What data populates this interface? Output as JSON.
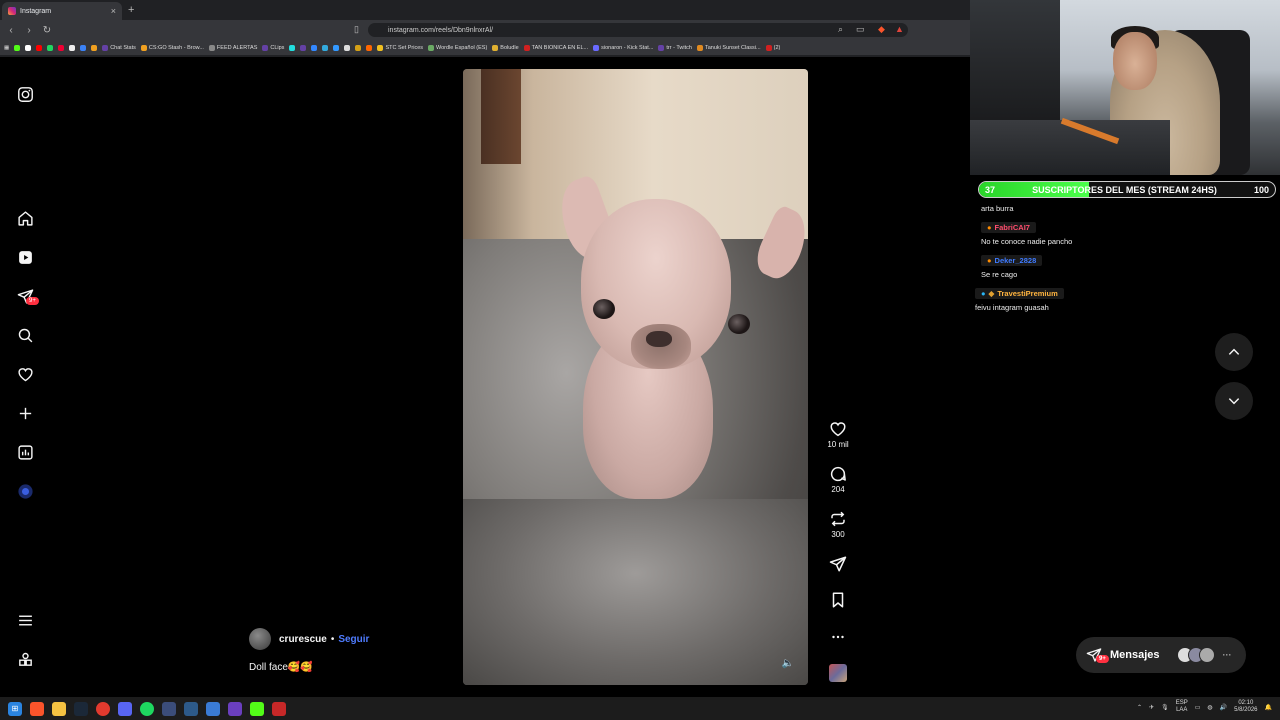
{
  "browser": {
    "tab_title": "Instagram",
    "tab_close": "×",
    "new_tab": "+",
    "url": "instagram.com/reels/Dbn9nlnxrAl/",
    "bookmarks": [
      {
        "label": "Chat Stats",
        "color": "#6441a5"
      },
      {
        "label": "CS:GO Stash - Brow...",
        "color": "#f0a020"
      },
      {
        "label": "FEED ALERTAS",
        "color": "#555555"
      },
      {
        "label": "CLips",
        "color": "#6441a5"
      },
      {
        "label": "STC Set Prices",
        "color": "#f0c020"
      },
      {
        "label": "Wordle Español (ES)",
        "color": "#6aaa64"
      },
      {
        "label": "Boludle",
        "color": "#e0b030"
      },
      {
        "label": "TAN BIONICA EN EL...",
        "color": "#d02020"
      },
      {
        "label": "sionaron - Kick Stat...",
        "color": "#6a6aff"
      },
      {
        "label": "trr - Twitch",
        "color": "#6441a5"
      },
      {
        "label": "Tanuki Sunset Classi...",
        "color": "#e08a20"
      },
      {
        "label": "(2)",
        "color": "#d02020"
      }
    ]
  },
  "reel": {
    "likes": "10 mil",
    "comments": "204",
    "reposts": "300",
    "author": "crurescue",
    "separator": "•",
    "follow_label": "Seguir",
    "caption": "Doll face🥰🥰"
  },
  "sidebar": {
    "notif_badge": "9+"
  },
  "stream": {
    "sub_goal_current": "37",
    "sub_goal_label": "SUSCRIPTORES DEL MES (STREAM 24HS)",
    "sub_goal_target": "100",
    "sub_goal_fraction": 0.37,
    "chat": [
      {
        "user": "",
        "text": "arta burra",
        "color": "#ffffff"
      },
      {
        "user": "FabriCAI7",
        "text": "No te conoce nadie pancho",
        "color": "#ff4d6d"
      },
      {
        "user": "Deker_2828",
        "text": "Se re cago",
        "color": "#3f7bff"
      },
      {
        "user": "TravestiPremium",
        "text": "feivu intagram guasah",
        "color": "#ffb43f"
      }
    ]
  },
  "messages": {
    "label": "Mensajes",
    "badge": "9+",
    "more": "···"
  },
  "taskbar": {
    "lang_top": "ESP",
    "lang_bottom": "LAA",
    "time": "02:10",
    "date": "5/8/2026"
  }
}
